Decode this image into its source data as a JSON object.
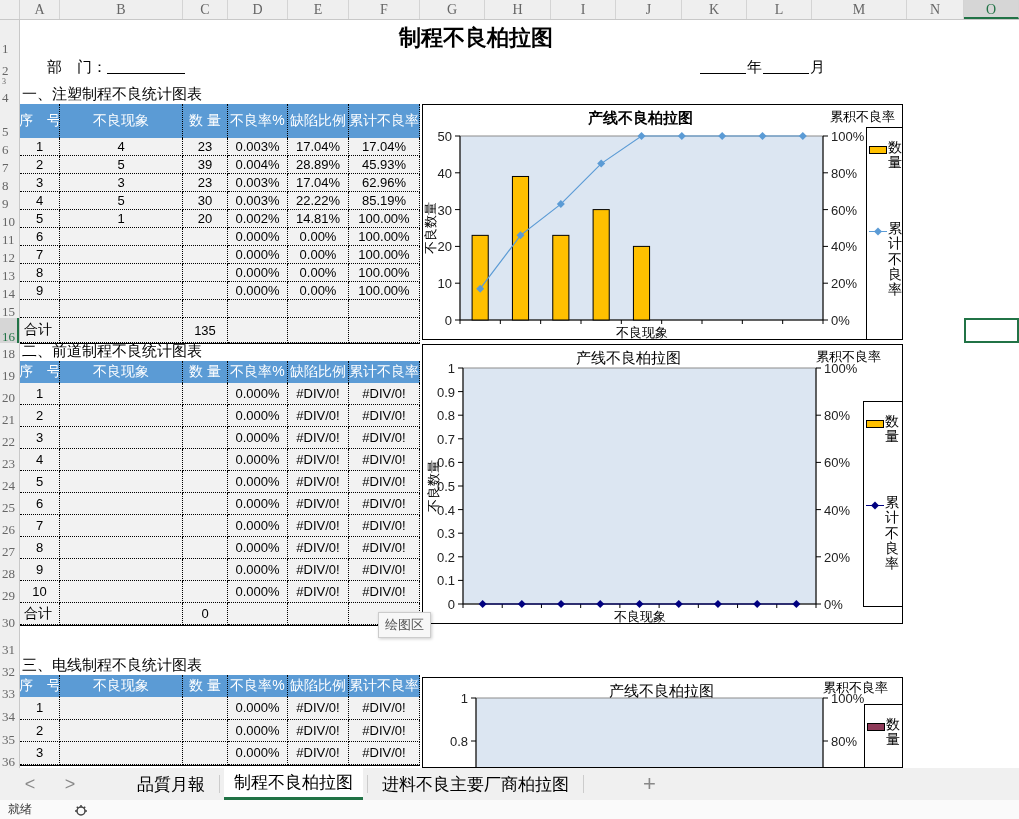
{
  "columns": [
    {
      "label": "A",
      "selected": false
    },
    {
      "label": "B",
      "selected": false
    },
    {
      "label": "C",
      "selected": false
    },
    {
      "label": "D",
      "selected": false
    },
    {
      "label": "E",
      "selected": false
    },
    {
      "label": "F",
      "selected": false
    },
    {
      "label": "G",
      "selected": false
    },
    {
      "label": "H",
      "selected": false
    },
    {
      "label": "I",
      "selected": false
    },
    {
      "label": "J",
      "selected": false
    },
    {
      "label": "K",
      "selected": false
    },
    {
      "label": "L",
      "selected": false
    },
    {
      "label": "M",
      "selected": false
    },
    {
      "label": "N",
      "selected": false
    },
    {
      "label": "O",
      "selected": true
    }
  ],
  "rows": [
    {
      "label": "1",
      "selected": false
    },
    {
      "label": "2",
      "selected": false
    },
    {
      "label": "3",
      "selected": false
    },
    {
      "label": "4",
      "selected": false
    },
    {
      "label": "5",
      "selected": false
    },
    {
      "label": "6",
      "selected": false
    },
    {
      "label": "7",
      "selected": false
    },
    {
      "label": "8",
      "selected": false
    },
    {
      "label": "9",
      "selected": false
    },
    {
      "label": "10",
      "selected": false
    },
    {
      "label": "11",
      "selected": false
    },
    {
      "label": "12",
      "selected": false
    },
    {
      "label": "13",
      "selected": false
    },
    {
      "label": "14",
      "selected": false
    },
    {
      "label": "15",
      "selected": false
    },
    {
      "label": "16",
      "selected": true
    },
    {
      "label": "18",
      "selected": false
    },
    {
      "label": "19",
      "selected": false
    },
    {
      "label": "20",
      "selected": false
    },
    {
      "label": "21",
      "selected": false
    },
    {
      "label": "22",
      "selected": false
    },
    {
      "label": "23",
      "selected": false
    },
    {
      "label": "24",
      "selected": false
    },
    {
      "label": "25",
      "selected": false
    },
    {
      "label": "26",
      "selected": false
    },
    {
      "label": "27",
      "selected": false
    },
    {
      "label": "28",
      "selected": false
    },
    {
      "label": "29",
      "selected": false
    },
    {
      "label": "30",
      "selected": false
    },
    {
      "label": "31",
      "selected": false
    },
    {
      "label": "32",
      "selected": false
    },
    {
      "label": "33",
      "selected": false
    },
    {
      "label": "34",
      "selected": false
    },
    {
      "label": "35",
      "selected": false
    },
    {
      "label": "36",
      "selected": false
    }
  ],
  "title": "制程不良柏拉图",
  "department": {
    "label": "部　门："
  },
  "date": {
    "year": "年",
    "month": "月"
  },
  "tables": [
    {
      "heading": "一、注塑制程不良统计图表",
      "columns": [
        "序　号",
        "不良现象",
        "数 量",
        "不良率%",
        "缺陷比例",
        "累计不良率"
      ],
      "rows": [
        {
          "no": "1",
          "phenomenon": "4",
          "qty": "23",
          "rate": "0.003%",
          "ratio": "17.04%",
          "cumulative": "17.04%"
        },
        {
          "no": "2",
          "phenomenon": "5",
          "qty": "39",
          "rate": "0.004%",
          "ratio": "28.89%",
          "cumulative": "45.93%"
        },
        {
          "no": "3",
          "phenomenon": "3",
          "qty": "23",
          "rate": "0.003%",
          "ratio": "17.04%",
          "cumulative": "62.96%"
        },
        {
          "no": "4",
          "phenomenon": "5",
          "qty": "30",
          "rate": "0.003%",
          "ratio": "22.22%",
          "cumulative": "85.19%"
        },
        {
          "no": "5",
          "phenomenon": "1",
          "qty": "20",
          "rate": "0.002%",
          "ratio": "14.81%",
          "cumulative": "100.00%"
        },
        {
          "no": "6",
          "rate": "0.000%",
          "ratio": "0.00%",
          "cumulative": "100.00%"
        },
        {
          "no": "7",
          "rate": "0.000%",
          "ratio": "0.00%",
          "cumulative": "100.00%"
        },
        {
          "no": "8",
          "rate": "0.000%",
          "ratio": "0.00%",
          "cumulative": "100.00%"
        },
        {
          "no": "9",
          "rate": "0.000%",
          "ratio": "0.00%",
          "cumulative": "100.00%"
        },
        {}
      ],
      "total": {
        "label": "合计",
        "qty": "135"
      }
    },
    {
      "heading": "二、前道制程不良统计图表",
      "columns": [
        "序　号",
        "不良现象",
        "数 量",
        "不良率%",
        "缺陷比例",
        "累计不良率"
      ],
      "rows": [
        {
          "no": "1",
          "rate": "0.000%",
          "ratio": "#DIV/0!",
          "cumulative": "#DIV/0!"
        },
        {
          "no": "2",
          "rate": "0.000%",
          "ratio": "#DIV/0!",
          "cumulative": "#DIV/0!"
        },
        {
          "no": "3",
          "rate": "0.000%",
          "ratio": "#DIV/0!",
          "cumulative": "#DIV/0!"
        },
        {
          "no": "4",
          "rate": "0.000%",
          "ratio": "#DIV/0!",
          "cumulative": "#DIV/0!"
        },
        {
          "no": "5",
          "rate": "0.000%",
          "ratio": "#DIV/0!",
          "cumulative": "#DIV/0!"
        },
        {
          "no": "6",
          "rate": "0.000%",
          "ratio": "#DIV/0!",
          "cumulative": "#DIV/0!"
        },
        {
          "no": "7",
          "rate": "0.000%",
          "ratio": "#DIV/0!",
          "cumulative": "#DIV/0!"
        },
        {
          "no": "8",
          "rate": "0.000%",
          "ratio": "#DIV/0!",
          "cumulative": "#DIV/0!"
        },
        {
          "no": "9",
          "rate": "0.000%",
          "ratio": "#DIV/0!",
          "cumulative": "#DIV/0!"
        },
        {
          "no": "10",
          "rate": "0.000%",
          "ratio": "#DIV/0!",
          "cumulative": "#DIV/0!"
        }
      ],
      "total": {
        "label": "合计",
        "qty": "0"
      }
    },
    {
      "heading": "三、电线制程不良统计图表",
      "columns": [
        "序　号",
        "不良现象",
        "数 量",
        "不良率%",
        "缺陷比例",
        "累计不良率"
      ],
      "rows": [
        {
          "no": "1",
          "rate": "0.000%",
          "ratio": "#DIV/0!",
          "cumulative": "#DIV/0!"
        },
        {
          "no": "2",
          "rate": "0.000%",
          "ratio": "#DIV/0!",
          "cumulative": "#DIV/0!"
        },
        {
          "no": "3",
          "rate": "0.000%",
          "ratio": "#DIV/0!",
          "cumulative": "#DIV/0!"
        }
      ]
    }
  ],
  "charts": [
    {
      "kind": "pareto",
      "title_bold": true,
      "bars": {
        "chart_data": {
          "type": "bar",
          "title": "产线不良柏拉图",
          "xlabel": "不良现象",
          "ylabel": "不良数量",
          "categories": [
            null,
            null,
            null,
            null,
            null,
            null,
            null,
            null,
            null
          ],
          "ylim": [
            0,
            50
          ],
          "yticks": [
            0,
            10,
            20,
            30,
            40,
            50
          ],
          "series": [
            {
              "name": "数量",
              "color": "#ffc000",
              "values": [
                23,
                39,
                23,
                30,
                20,
                null,
                null,
                null,
                null
              ]
            }
          ]
        }
      },
      "cumulative": {
        "chart_data": {
          "type": "line",
          "ylabel": "累积不良率",
          "categories": [
            null,
            null,
            null,
            null,
            null,
            null,
            null,
            null,
            null
          ],
          "ylim": [
            0,
            100
          ],
          "yticks": [
            {
              "value": 0,
              "label": "0%"
            },
            {
              "value": 20,
              "label": "20%"
            },
            {
              "value": 40,
              "label": "40%"
            },
            {
              "value": 60,
              "label": "60%"
            },
            {
              "value": 80,
              "label": "80%"
            },
            {
              "value": 100,
              "label": "100%"
            }
          ],
          "series": [
            {
              "name": "累计不良率",
              "color": "#5b9bd5",
              "marker": "diamond",
              "values": [
                17,
                46,
                63,
                85,
                100,
                100,
                100,
                100,
                100
              ]
            }
          ]
        }
      }
    },
    {
      "kind": "pareto",
      "title_bold": false,
      "bars": {
        "chart_data": {
          "type": "bar",
          "title": "产线不良柏拉图",
          "xlabel": "不良现象",
          "ylabel": "不良数量",
          "categories": [
            null,
            null,
            null,
            null,
            null,
            null,
            null,
            null,
            null
          ],
          "ylim": [
            0,
            1
          ],
          "yticks": [
            0,
            0.1,
            0.2,
            0.3,
            0.4,
            0.5,
            0.6,
            0.7,
            0.8,
            0.9,
            1
          ],
          "series": [
            {
              "name": "数量",
              "color": "#ffc000",
              "values": [
                0,
                0,
                0,
                0,
                0,
                0,
                0,
                0,
                0
              ]
            }
          ]
        }
      },
      "cumulative": {
        "chart_data": {
          "type": "line",
          "ylabel": "累积不良率",
          "categories": [
            null,
            null,
            null,
            null,
            null,
            null,
            null,
            null,
            null
          ],
          "ylim": [
            0,
            100
          ],
          "yticks": [
            {
              "value": 0,
              "label": "0%"
            },
            {
              "value": 20,
              "label": "20%"
            },
            {
              "value": 40,
              "label": "40%"
            },
            {
              "value": 60,
              "label": "60%"
            },
            {
              "value": 80,
              "label": "80%"
            },
            {
              "value": 100,
              "label": "100%"
            }
          ],
          "series": [
            {
              "name": "累计不良率",
              "color": "#000080",
              "marker": "diamond",
              "values": [
                0,
                0,
                0,
                0,
                0,
                0,
                0,
                0,
                0
              ]
            }
          ]
        }
      }
    },
    {
      "kind": "cut",
      "title_bold": false,
      "title": "产线不良柏拉图",
      "right_label": "累积不良率",
      "y_ticks": [
        "1",
        "0.8"
      ],
      "right_ticks": [
        "100%",
        "80%"
      ],
      "legend": [
        {
          "name": "数量",
          "color": "#8e3a59"
        }
      ]
    }
  ],
  "tooltip": "绘图区",
  "nav": [
    "<",
    ">"
  ],
  "sheet_tabs": [
    {
      "label": "品質月報",
      "selected": false
    },
    {
      "label": "制程不良柏拉图",
      "selected": true
    },
    {
      "label": "进料不良主要厂商柏拉图",
      "selected": false
    }
  ],
  "add_tab": "+",
  "status": "就绪"
}
